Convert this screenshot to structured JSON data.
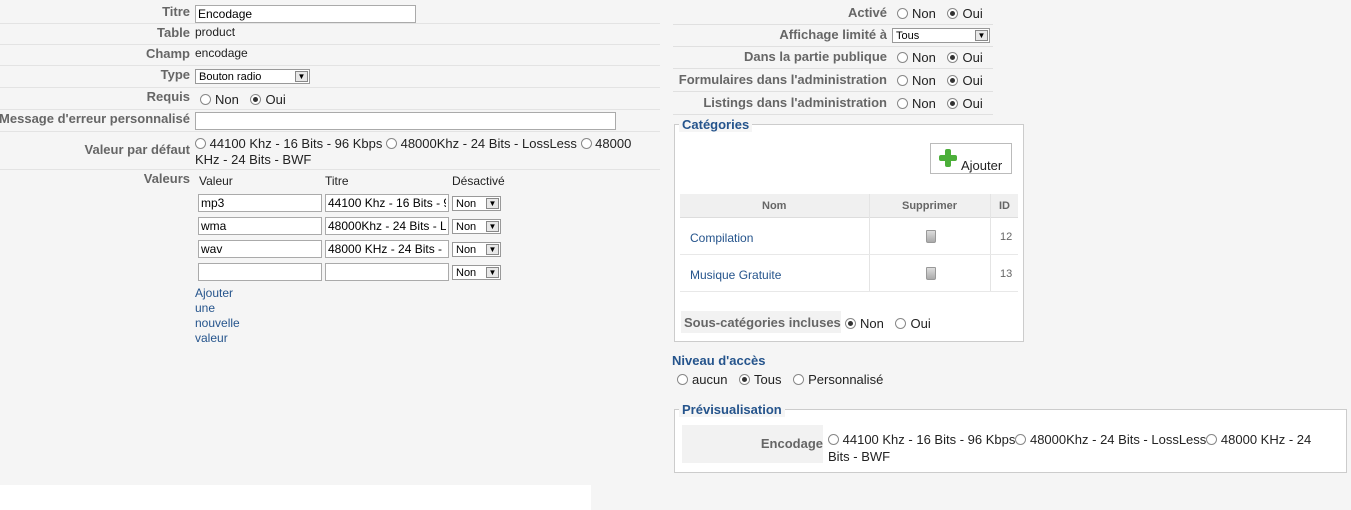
{
  "left": {
    "titre": {
      "label": "Titre",
      "value": "Encodage"
    },
    "table": {
      "label": "Table",
      "value": "product"
    },
    "champ": {
      "label": "Champ",
      "value": "encodage"
    },
    "type": {
      "label": "Type",
      "value": "Bouton radio"
    },
    "requis": {
      "label": "Requis",
      "no": "Non",
      "yes": "Oui",
      "selected": "Oui"
    },
    "message": {
      "label": "Message d'erreur personnalisé",
      "value": ""
    },
    "default": {
      "label": "Valeur par défaut",
      "opt1": "44100 Khz - 16 Bits - 96 Kbps",
      "opt2": "48000Khz - 24 Bits - LossLess",
      "opt3a": "48000",
      "opt3b": "KHz - 24 Bits - BWF"
    },
    "valeurs": {
      "label": "Valeurs",
      "col_valeur": "Valeur",
      "col_titre": "Titre",
      "col_desactive": "Désactivé",
      "rows": [
        {
          "valeur": "mp3",
          "titre": "44100 Khz - 16 Bits - 9",
          "desactive": "Non"
        },
        {
          "valeur": "wma",
          "titre": "48000Khz - 24 Bits - L",
          "desactive": "Non"
        },
        {
          "valeur": "wav",
          "titre": "48000 KHz - 24 Bits - I",
          "desactive": "Non"
        },
        {
          "valeur": "",
          "titre": "",
          "desactive": "Non"
        }
      ],
      "add_link": "Ajouter une nouvelle valeur"
    }
  },
  "right": {
    "active": {
      "label": "Activé",
      "no": "Non",
      "yes": "Oui",
      "selected": "Oui"
    },
    "affichage": {
      "label": "Affichage limité à",
      "value": "Tous"
    },
    "publique": {
      "label": "Dans la partie publique",
      "no": "Non",
      "yes": "Oui",
      "selected": "Oui"
    },
    "formulaires": {
      "label": "Formulaires dans l'administration",
      "no": "Non",
      "yes": "Oui",
      "selected": "Oui"
    },
    "listings": {
      "label": "Listings dans l'administration",
      "no": "Non",
      "yes": "Oui",
      "selected": "Oui"
    },
    "categories": {
      "legend": "Catégories",
      "add_button": "Ajouter",
      "col_nom": "Nom",
      "col_supprimer": "Supprimer",
      "col_id": "ID",
      "rows": [
        {
          "nom": "Compilation",
          "id": "12"
        },
        {
          "nom": "Musique Gratuite",
          "id": "13"
        }
      ],
      "subcat_label": "Sous-catégories incluses",
      "subcat_no": "Non",
      "subcat_yes": "Oui",
      "subcat_selected": "Non"
    },
    "niveau": {
      "title": "Niveau d'accès",
      "opt1": "aucun",
      "opt2": "Tous",
      "opt3": "Personnalisé",
      "selected": "Tous"
    },
    "preview": {
      "legend": "Prévisualisation",
      "label": "Encodage",
      "opt1": "44100 Khz - 16 Bits - 96 Kbps",
      "opt2": "48000Khz - 24 Bits - LossLess",
      "opt3a": "48000 KHz - 24",
      "opt3b": "Bits - BWF"
    }
  }
}
